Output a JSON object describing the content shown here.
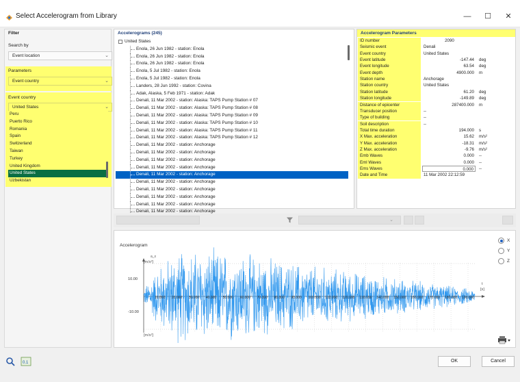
{
  "window": {
    "title": "Select Accelerogram from Library",
    "minimize": "—",
    "maximize": "☐",
    "close": "✕"
  },
  "filter": {
    "header": "Filter",
    "search_by_label": "Search by",
    "search_by_value": "Event location",
    "parameters_label": "Parameters",
    "parameters_value": "Event country",
    "country_label": "Event country",
    "country_value": "United States",
    "country_options": [
      "Peru",
      "Puerto Rico",
      "Romania",
      "Spain",
      "Switzerland",
      "Taiwan",
      "Turkey",
      "United Kingdom",
      "United States",
      "Uzbekistan"
    ],
    "selected_option": "United States"
  },
  "accelerograms": {
    "header": "Accelerograms (245)",
    "root": "United States",
    "rows": [
      "Enola, 26 Jun 1982 - station: Enola",
      "Enola, 26 Jun 1982 - station: Enola",
      "Enola, 26 Jun 1982 - station: Enola",
      "Enola, 5 Jul 1982 - station: Enola",
      "Enola, 5 Jul 1982 - station: Enola",
      "Landers, 28 Jun 1992 - station: Covina",
      "Adak, Alaska, 5 Feb 1971 - station: Adak",
      "Denali, 11 Mar 2002 - station: Alaska: TAPS Pump Station # 07",
      "Denali, 11 Mar 2002 - station: Alaska: TAPS Pump Station # 08",
      "Denali, 11 Mar 2002 - station: Alaska: TAPS Pump Station # 09",
      "Denali, 11 Mar 2002 - station: Alaska: TAPS Pump Station # 10",
      "Denali, 11 Mar 2002 - station: Alaska: TAPS Pump Station # 11",
      "Denali, 11 Mar 2002 - station: Alaska: TAPS Pump Station # 12",
      "Denali, 11 Mar 2002 - station: Anchorage",
      "Denali, 11 Mar 2002 - station: Anchorage",
      "Denali, 11 Mar 2002 - station: Anchorage",
      "Denali, 11 Mar 2002 - station: Anchorage",
      "Denali, 11 Mar 2002 - station: Anchorage",
      "Denali, 11 Mar 2002 - station: Anchorage",
      "Denali, 11 Mar 2002 - station: Anchorage",
      "Denali, 11 Mar 2002 - station: Anchorage",
      "Denali, 11 Mar 2002 - station: Anchorage",
      "Denali, 11 Mar 2002 - station: Anchorage"
    ],
    "selected_index": 17
  },
  "parameters": {
    "header": "Accelerogram Parameters",
    "rows": [
      {
        "key": "ID number",
        "value": "2090",
        "unit": "",
        "align": "ctr"
      },
      {
        "key": "Seismic event",
        "value": "Denali",
        "unit": "",
        "align": ""
      },
      {
        "key": "Event country",
        "value": "United States",
        "unit": "",
        "align": ""
      },
      {
        "key": "Event latitude",
        "value": "-147.44",
        "unit": "deg",
        "align": "num"
      },
      {
        "key": "Event longitude",
        "value": "63.54",
        "unit": "deg",
        "align": "num"
      },
      {
        "key": "Event depth",
        "value": "4900.000",
        "unit": "m",
        "align": "num"
      },
      {
        "key": "Station name",
        "value": "Anchorage",
        "unit": "",
        "align": ""
      },
      {
        "key": "Station country",
        "value": "United States",
        "unit": "",
        "align": ""
      },
      {
        "key": "Station latitude",
        "value": "61.20",
        "unit": "deg",
        "align": "num"
      },
      {
        "key": "Station longitude",
        "value": "-149.89",
        "unit": "deg",
        "align": "num"
      },
      {
        "key": "Distance of epicenter",
        "value": "287400.000",
        "unit": "m",
        "align": "num"
      },
      {
        "key": "Transducer position",
        "value": "--",
        "unit": "",
        "align": ""
      },
      {
        "key": "Type of building",
        "value": "--",
        "unit": "",
        "align": ""
      },
      {
        "key": "Soil description",
        "value": "--",
        "unit": "",
        "align": ""
      },
      {
        "key": "Total time duration",
        "value": "194.000",
        "unit": "s",
        "align": "num"
      },
      {
        "key": "X Max. acceleration",
        "value": "15.62",
        "unit": "m/s²",
        "align": "num"
      },
      {
        "key": "Y Max. acceleration",
        "value": "-18.31",
        "unit": "m/s²",
        "align": "num"
      },
      {
        "key": "Z Max. acceleration",
        "value": "-9.76",
        "unit": "m/s²",
        "align": "num"
      },
      {
        "key": "Emb Waves",
        "value": "0.000",
        "unit": "--",
        "align": "num"
      },
      {
        "key": "Eml Waves",
        "value": "0.000",
        "unit": "--",
        "align": "num"
      },
      {
        "key": "Ems Waves",
        "value": "0.000",
        "unit": "--",
        "align": "num",
        "boxed": true
      },
      {
        "key": "Date and Time",
        "value": "11 Mar 2002 22:12:59",
        "unit": "",
        "align": ""
      }
    ]
  },
  "chart": {
    "title": "Accelerogram",
    "y_axis_var": "a_x",
    "y_unit": "[m/s²]",
    "y_unit_bottom": "[m/s²]",
    "x_var": "t",
    "x_unit": "[s]",
    "ytick_pos": "10.00",
    "ytick_neg": "-10.00",
    "xtick_labels": [
      "10.000",
      "20.000",
      "30.000",
      "40.000",
      "50.000",
      "60.000",
      "70.000",
      "80.000",
      "90.000",
      "100.000",
      "110.000",
      "120.000",
      "130.000",
      "140.000",
      "150.000",
      "160.000",
      "170.000",
      "180.000",
      "190.000"
    ],
    "radio": [
      {
        "label": "X",
        "checked": true
      },
      {
        "label": "Y",
        "checked": false
      },
      {
        "label": "Z",
        "checked": false
      }
    ]
  },
  "chart_data": {
    "type": "line",
    "title": "Accelerogram",
    "xlabel": "t [s]",
    "ylabel": "a_x [m/s²]",
    "xlim": [
      0,
      194
    ],
    "ylim": [
      -16,
      16
    ],
    "series": [
      {
        "name": "X",
        "peak": 15.62,
        "trough": -15.62,
        "duration": 194.0
      }
    ]
  },
  "buttons": {
    "ok": "OK",
    "cancel": "Cancel"
  },
  "colors": {
    "highlight": "#ffff70",
    "selection": "#0062c4",
    "country_selection": "#0a6e43",
    "signal": "#3399ee"
  }
}
